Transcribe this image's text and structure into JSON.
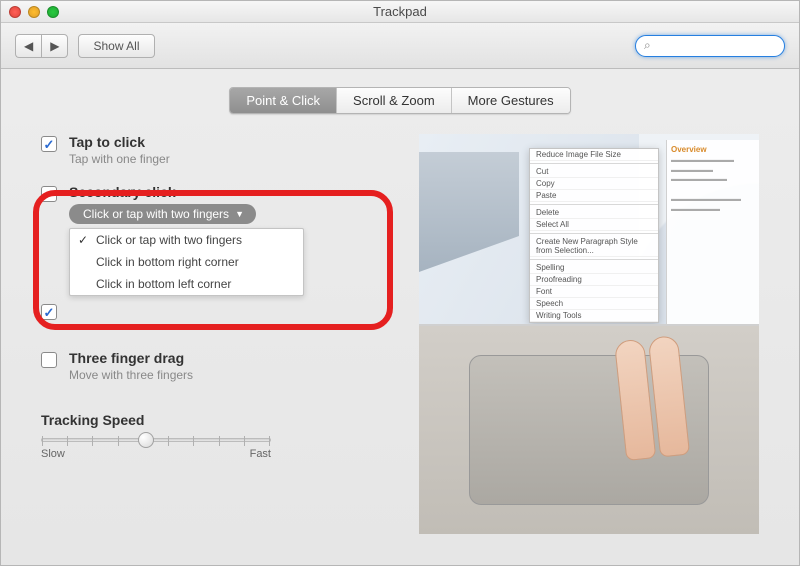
{
  "window": {
    "title": "Trackpad"
  },
  "toolbar": {
    "back_label": "◀",
    "fwd_label": "▶",
    "showall_label": "Show All",
    "search_icon": "⌕",
    "search_placeholder": ""
  },
  "tabs": [
    {
      "label": "Point & Click",
      "active": true
    },
    {
      "label": "Scroll & Zoom",
      "active": false
    },
    {
      "label": "More Gestures",
      "active": false
    }
  ],
  "options": {
    "tap": {
      "title": "Tap to click",
      "sub": "Tap with one finger",
      "checked": true
    },
    "secondary": {
      "title": "Secondary click",
      "pill": "Click or tap with two fingers",
      "checked": true,
      "menu": [
        {
          "label": "Click or tap with two fingers",
          "selected": true
        },
        {
          "label": "Click in bottom right corner",
          "selected": false
        },
        {
          "label": "Click in bottom left corner",
          "selected": false
        }
      ]
    },
    "partial_checked": {
      "checked": true
    },
    "threefinger": {
      "title": "Three finger drag",
      "sub": "Move with three fingers",
      "checked": false
    }
  },
  "tracking": {
    "label": "Tracking Speed",
    "min_label": "Slow",
    "max_label": "Fast"
  },
  "preview_menu": {
    "items": [
      "Reduce Image File Size",
      "Cut",
      "Copy",
      "Paste",
      "Delete",
      "Select All",
      "Create New Paragraph Style from Selection...",
      "Spelling",
      "Proofreading",
      "Font",
      "Speech",
      "Writing Tools"
    ],
    "side_heading": "Overview"
  }
}
